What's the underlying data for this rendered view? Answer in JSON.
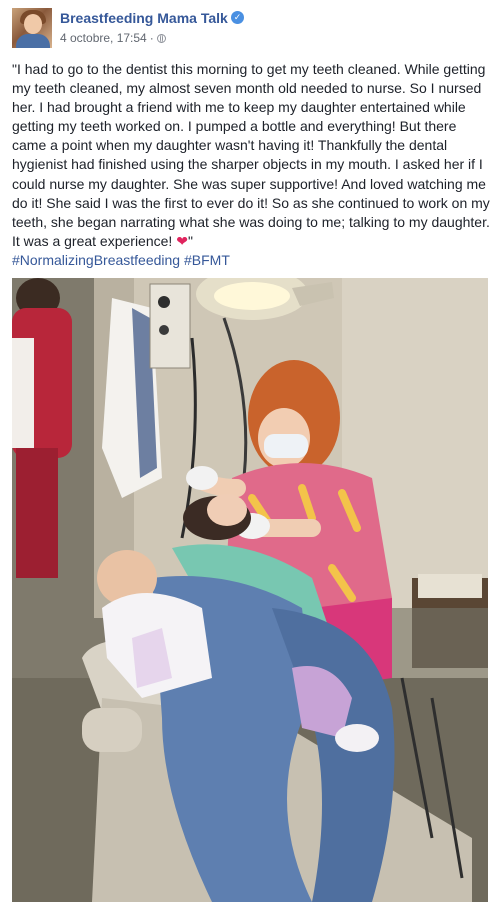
{
  "post": {
    "page_name": "Breastfeeding Mama Talk",
    "verified_icon": "verified-badge-icon",
    "date": "4 octobre, 17:54",
    "separator": "·",
    "privacy_icon": "globe-icon",
    "text": "\"I had to go to the dentist this morning to get my teeth cleaned. While getting my teeth cleaned, my almost seven month old needed to nurse. So I nursed her. I had brought a friend with me to keep my daughter entertained while getting my teeth worked on. I pumped a bottle and everything! But there came a point when my daughter wasn't having it! Thankfully the dental hygienist had finished using the sharper objects in my mouth. I asked her if I could nurse my daughter. She was super supportive! And loved watching me do it! She said I was the first to ever do it! So as she continued to work on my teeth, she began narrating what she was doing to me; talking to my daughter. It was a great experience! ",
    "heart": "❤",
    "text_end": "\"",
    "hashtags": [
      "#NormalizingBreastfeeding",
      "#BFMT"
    ]
  },
  "colors": {
    "link": "#365899",
    "meta": "#616770",
    "heart": "#e0245e",
    "verified": "#4a90e2"
  }
}
